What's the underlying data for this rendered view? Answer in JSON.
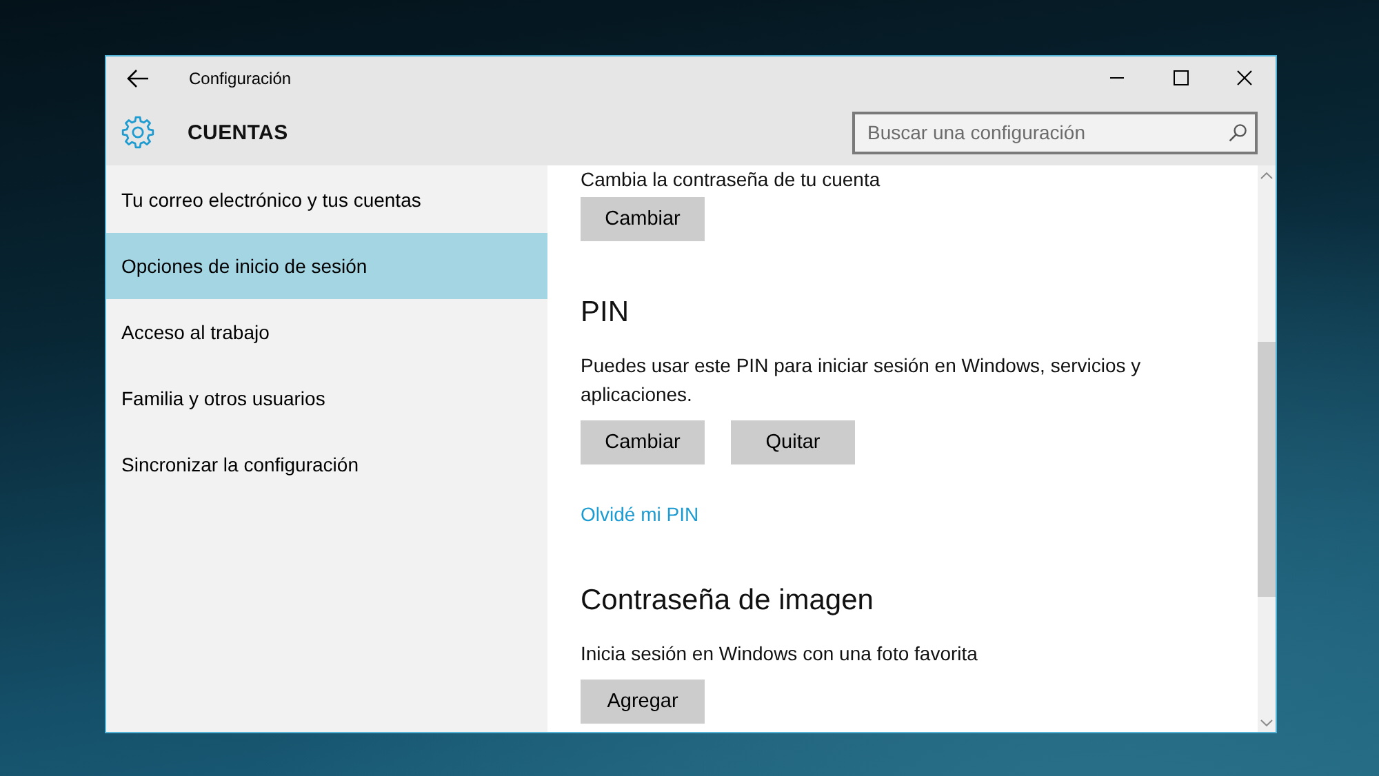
{
  "window": {
    "title": "Configuración"
  },
  "header": {
    "title": "CUENTAS",
    "search": {
      "placeholder": "Buscar una configuración"
    }
  },
  "sidebar": {
    "items": [
      {
        "label": "Tu correo electrónico y tus cuentas",
        "selected": false
      },
      {
        "label": "Opciones de inicio de sesión",
        "selected": true
      },
      {
        "label": "Acceso al trabajo",
        "selected": false
      },
      {
        "label": "Familia y otros usuarios",
        "selected": false
      },
      {
        "label": "Sincronizar la configuración",
        "selected": false
      }
    ]
  },
  "content": {
    "sections": [
      {
        "description": "Cambia la contraseña de tu cuenta",
        "buttons": [
          "Cambiar"
        ]
      },
      {
        "heading": "PIN",
        "description": "Puedes usar este PIN para iniciar sesión en Windows, servicios y aplicaciones.",
        "buttons": [
          "Cambiar",
          "Quitar"
        ],
        "link": "Olvidé mi PIN"
      },
      {
        "heading": "Contraseña de imagen",
        "description": "Inicia sesión en Windows con una foto favorita",
        "buttons": [
          "Agregar"
        ]
      }
    ]
  }
}
